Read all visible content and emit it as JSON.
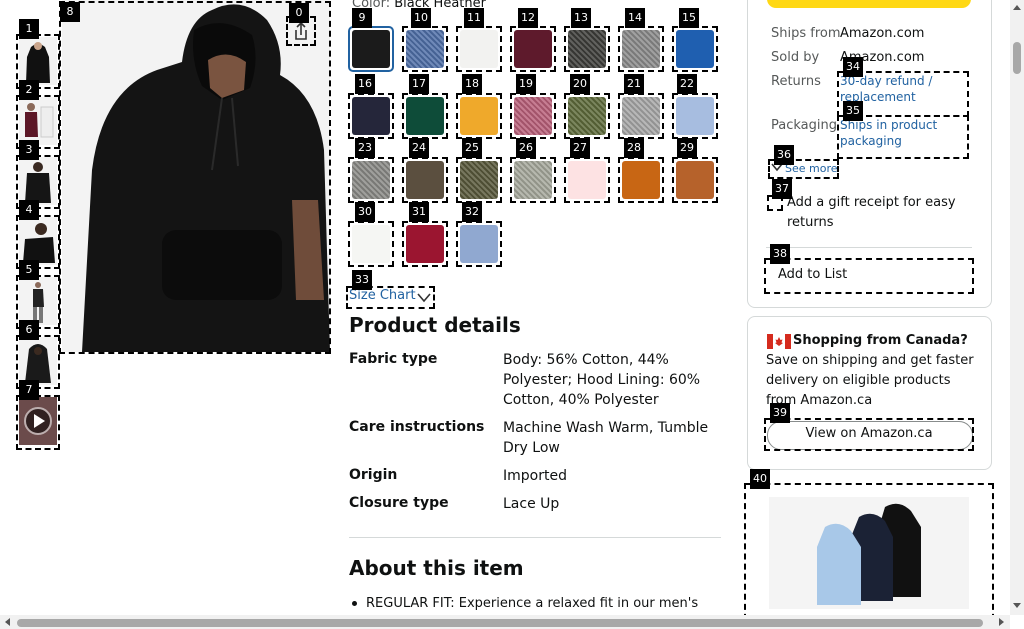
{
  "color_line": {
    "label": "Color:",
    "value": "Black Heather"
  },
  "badges": [
    "0",
    "1",
    "2",
    "3",
    "4",
    "5",
    "6",
    "7",
    "8",
    "9",
    "10",
    "11",
    "12",
    "13",
    "14",
    "15",
    "16",
    "17",
    "18",
    "19",
    "20",
    "21",
    "22",
    "23",
    "24",
    "25",
    "26",
    "27",
    "28",
    "29",
    "30",
    "31",
    "32",
    "33",
    "34",
    "35",
    "36",
    "37",
    "38",
    "39",
    "40"
  ],
  "swatches": [
    {
      "num": "9",
      "color": "#1b1b1b",
      "pattern": false
    },
    {
      "num": "10",
      "color": "#4f6fa8",
      "pattern": true
    },
    {
      "num": "11",
      "color": "#f2f2f0",
      "pattern": false
    },
    {
      "num": "12",
      "color": "#5e1a2c",
      "pattern": false
    },
    {
      "num": "13",
      "color": "#3e3e3a",
      "pattern": true
    },
    {
      "num": "14",
      "color": "#8b8b8b",
      "pattern": true
    },
    {
      "num": "15",
      "color": "#1f5fb0",
      "pattern": false
    },
    {
      "num": "16",
      "color": "#25263a",
      "pattern": false
    },
    {
      "num": "17",
      "color": "#0e4c39",
      "pattern": false
    },
    {
      "num": "18",
      "color": "#efa92b",
      "pattern": false
    },
    {
      "num": "19",
      "color": "#b9607a",
      "pattern": true
    },
    {
      "num": "20",
      "color": "#5e6b3b",
      "pattern": true
    },
    {
      "num": "21",
      "color": "#a7a7a7",
      "pattern": true
    },
    {
      "num": "22",
      "color": "#a7bde0",
      "pattern": false
    },
    {
      "num": "23",
      "color": "#8a8a86",
      "pattern": true
    },
    {
      "num": "24",
      "color": "#5b4f3f",
      "pattern": false
    },
    {
      "num": "25",
      "color": "#59593b",
      "pattern": true
    },
    {
      "num": "26",
      "color": "#a6a89c",
      "pattern": true
    },
    {
      "num": "27",
      "color": "#fde2e3",
      "pattern": false
    },
    {
      "num": "28",
      "color": "#c86614",
      "pattern": false
    },
    {
      "num": "29",
      "color": "#b6622b",
      "pattern": false
    },
    {
      "num": "30",
      "color": "#f5f6f3",
      "pattern": false
    },
    {
      "num": "31",
      "color": "#9b1530",
      "pattern": false
    },
    {
      "num": "32",
      "color": "#90a8d0",
      "pattern": false
    }
  ],
  "size_chart": "Size Chart",
  "product_details": {
    "title": "Product details",
    "rows": [
      {
        "key": "Fabric type",
        "value": "Body: 56% Cotton, 44% Polyester; Hood Lining: 60% Cotton, 40% Polyester"
      },
      {
        "key": "Care instructions",
        "value": "Machine Wash Warm, Tumble Dry Low"
      },
      {
        "key": "Origin",
        "value": "Imported"
      },
      {
        "key": "Closure type",
        "value": "Lace Up"
      }
    ]
  },
  "about": {
    "title": "About this item",
    "bullet1": "REGULAR FIT: Experience a relaxed fit in our men's"
  },
  "buybox": {
    "ships_from_label": "Ships from",
    "ships_from_value": "Amazon.com",
    "sold_by_label": "Sold by",
    "sold_by_value": "Amazon.com",
    "returns_label": "Returns",
    "returns_value": "30-day refund / replacement",
    "packaging_label": "Packaging",
    "packaging_value": "Ships in product packaging",
    "see_more": "See more",
    "gift_receipt": "Add a gift receipt for easy returns",
    "add_to_list": "Add to List"
  },
  "canada": {
    "title": "Shopping from Canada?",
    "text": "Save on shipping and get faster delivery on eligible products from Amazon.ca",
    "button": "View on Amazon.ca"
  },
  "colors": {
    "link": "#2162a1",
    "accent": "#ffd814",
    "selected": "#2162a1"
  }
}
